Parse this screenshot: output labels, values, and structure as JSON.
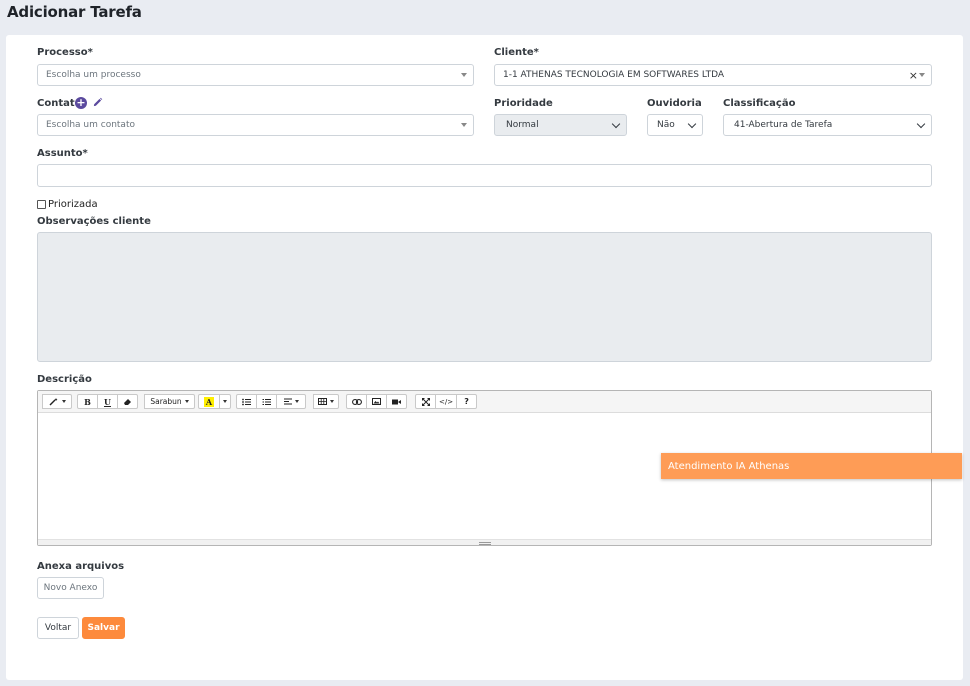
{
  "page": {
    "title": "Adicionar Tarefa"
  },
  "form": {
    "processo": {
      "label": "Processo*",
      "placeholder": "Escolha um processo"
    },
    "cliente": {
      "label": "Cliente*",
      "value": "1-1 ATHENAS TECNOLOGIA EM SOFTWARES LTDA",
      "clear": "×"
    },
    "contato": {
      "label": "Contato",
      "placeholder": "Escolha um contato",
      "add_icon": "plus-circle-icon",
      "edit_icon": "pencil-icon"
    },
    "prioridade": {
      "label": "Prioridade",
      "value": "Normal"
    },
    "ouvidoria": {
      "label": "Ouvidoria",
      "value": "Não"
    },
    "classificacao": {
      "label": "Classificação",
      "value": "41-Abertura de Tarefa"
    },
    "assunto": {
      "label": "Assunto*",
      "value": ""
    },
    "priorizada": {
      "label": "Priorizada",
      "checked": false
    },
    "observacoes": {
      "label": "Observações cliente"
    },
    "descricao": {
      "label": "Descrição",
      "toolbar": {
        "font_name": "Sarabun",
        "bold": "B",
        "underline": "U",
        "help": "?",
        "code": "</>"
      }
    },
    "anexos": {
      "label": "Anexa arquivos",
      "button": "Novo Anexo"
    }
  },
  "actions": {
    "back": "Voltar",
    "save": "Salvar"
  },
  "floating": {
    "text": "Atendimento IA Athenas"
  },
  "colors": {
    "accent": "#fd8a3c",
    "banner": "#fe9c56",
    "icon_purple": "#5b4a9e",
    "background": "#e9ecf2"
  }
}
